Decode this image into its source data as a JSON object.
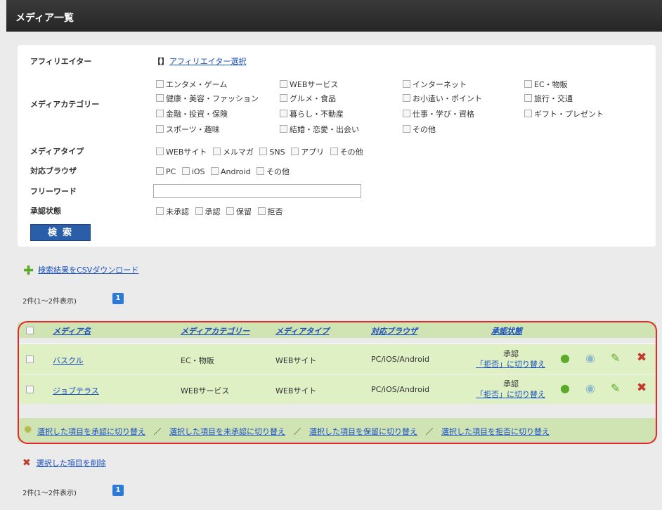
{
  "page_title": "メディア一覧",
  "filters": {
    "affiliator_label": "アフィリエイター",
    "affiliator_bracket": "【】",
    "affiliator_select": "アフィリエイター選択",
    "category_label": "メディアカテゴリー",
    "categories": [
      [
        "エンタメ・ゲーム",
        "WEBサービス",
        "インターネット",
        "EC・物販"
      ],
      [
        "健康・美容・ファッション",
        "グルメ・食品",
        "お小遣い・ポイント",
        "旅行・交通"
      ],
      [
        "金融・投資・保険",
        "暮らし・不動産",
        "仕事・学び・資格",
        "ギフト・プレゼント"
      ],
      [
        "スポーツ・趣味",
        "結婚・恋愛・出会い",
        "その他",
        ""
      ]
    ],
    "type_label": "メディアタイプ",
    "types": [
      "WEBサイト",
      "メルマガ",
      "SNS",
      "アプリ",
      "その他"
    ],
    "browser_label": "対応ブラウザ",
    "browsers": [
      "PC",
      "iOS",
      "Android",
      "その他"
    ],
    "freeword_label": "フリーワード",
    "freeword_value": "",
    "status_label": "承認状態",
    "statuses": [
      "未承認",
      "承認",
      "保留",
      "拒否"
    ],
    "search_button": "検索"
  },
  "csv_link": "検索結果をCSVダウンロード",
  "result_count": "2件(1～2件表示)",
  "current_page": "1",
  "table": {
    "headers": [
      "メディア名",
      "メディアカテゴリー",
      "メディアタイプ",
      "対応ブラウザ",
      "承認状態"
    ],
    "rows": [
      {
        "name": "バスクル",
        "category": "EC・物販",
        "type": "WEBサイト",
        "browser": "PC/iOS/Android",
        "status": "承認",
        "toggle": "「拒否」に切り替え"
      },
      {
        "name": "ジョブテラス",
        "category": "WEBサービス",
        "type": "WEBサイト",
        "browser": "PC/iOS/Android",
        "status": "承認",
        "toggle": "「拒否」に切り替え"
      }
    ],
    "bulk_actions": [
      "選択した項目を承認に切り替え",
      "選択した項目を未承認に切り替え",
      "選択した項目を保留に切り替え",
      "選択した項目を拒否に切り替え"
    ],
    "bulk_separator": "／"
  },
  "delete_selected": "選択した項目を削除",
  "colors": {
    "accent": "#2b5ea8",
    "row_bg": "#dff0c5",
    "header_bg": "#cfe3b3",
    "highlight": "#e12a2a"
  }
}
